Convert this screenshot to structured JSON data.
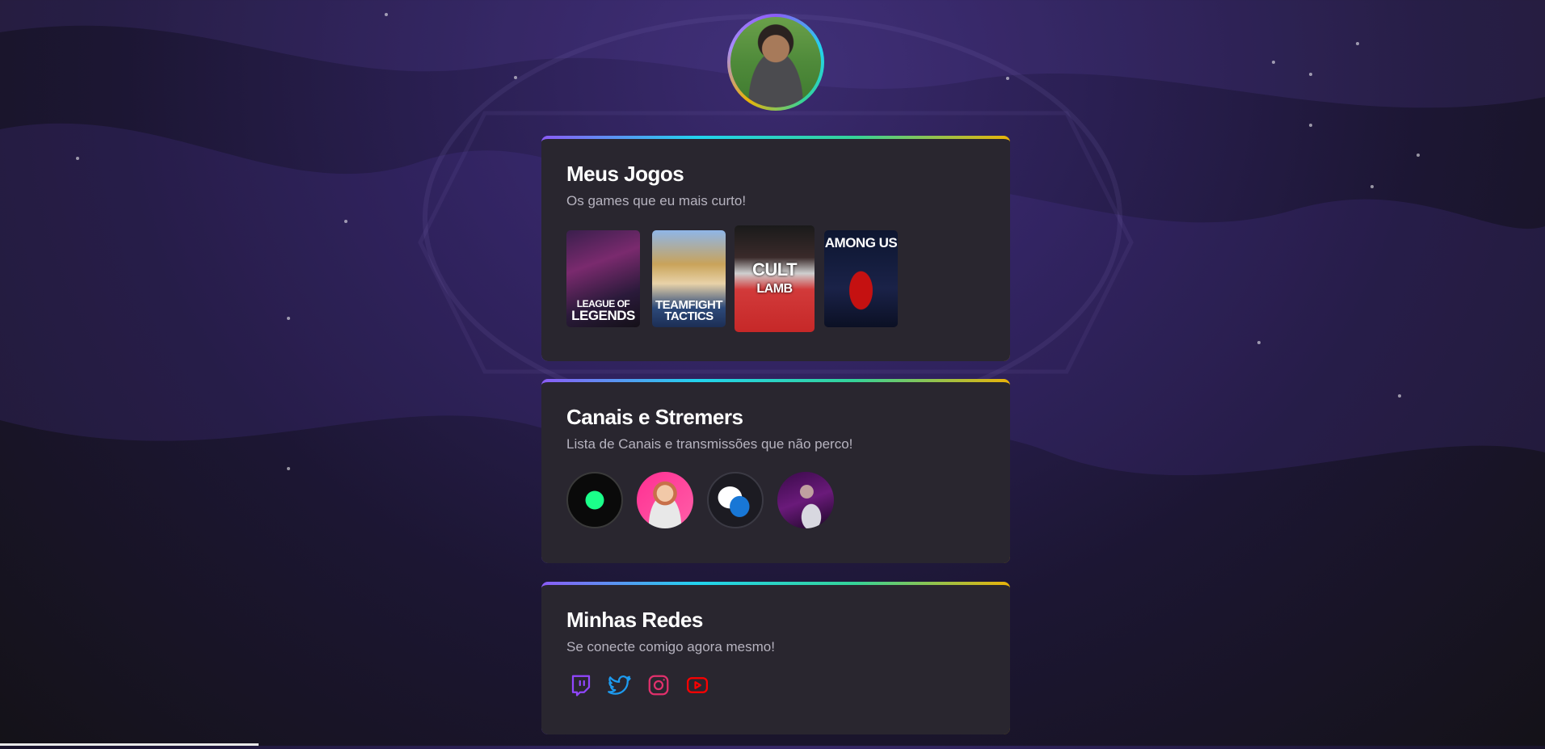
{
  "profile": {
    "avatar": "profile-photo"
  },
  "games_card": {
    "title": "Meus Jogos",
    "subtitle": "Os games que eu mais curto!",
    "games": [
      {
        "name": "League of Legends",
        "line1": "LEAGUE OF",
        "line2": "LEGENDS"
      },
      {
        "name": "Teamfight Tactics",
        "line1": "TEAMFIGHT",
        "line2": "TACTICS"
      },
      {
        "name": "Cult of the Lamb",
        "line1": "CULT",
        "line2": "LAMB"
      },
      {
        "name": "Among Us",
        "line1": "AMONG US",
        "line2": ""
      }
    ]
  },
  "channels_card": {
    "title": "Canais e Stremers",
    "subtitle": "Lista de Canais e transmissões que não perco!",
    "channels": [
      "channel-green-logo",
      "channel-anime-streamer",
      "channel-wing-logo",
      "channel-dj-streamer"
    ]
  },
  "socials_card": {
    "title": "Minhas Redes",
    "subtitle": "Se conecte comigo agora mesmo!",
    "networks": [
      {
        "icon": "twitch-icon",
        "color": "#9146ff"
      },
      {
        "icon": "twitter-icon",
        "color": "#1d9bf0"
      },
      {
        "icon": "instagram-icon",
        "color": "#e1306c"
      },
      {
        "icon": "youtube-icon",
        "color": "#ff0000"
      }
    ]
  }
}
